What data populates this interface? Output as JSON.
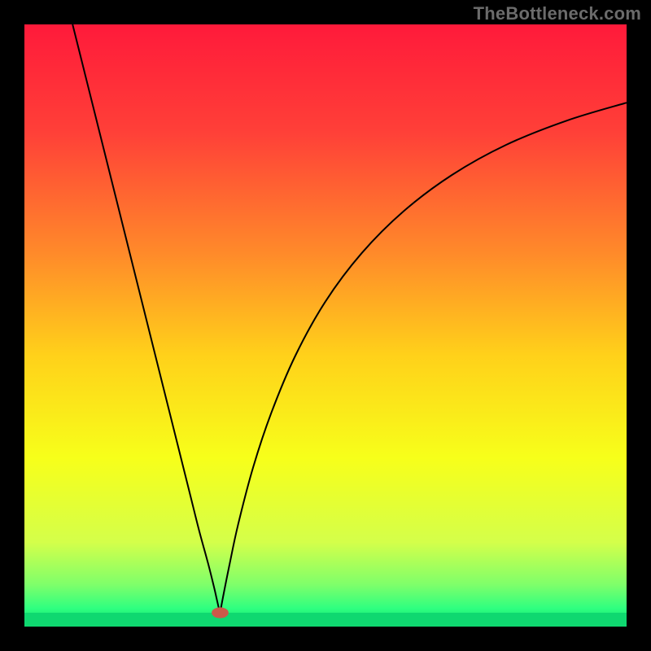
{
  "watermark": "TheBottleneck.com",
  "chart_data": {
    "type": "line",
    "title": "",
    "xlabel": "",
    "ylabel": "",
    "xlim": [
      0,
      100
    ],
    "ylim": [
      0,
      100
    ],
    "grid": false,
    "legend": false,
    "gradient_stops": [
      {
        "offset": 0.0,
        "color": "#ff1a3a"
      },
      {
        "offset": 0.18,
        "color": "#ff4038"
      },
      {
        "offset": 0.38,
        "color": "#ff8a2a"
      },
      {
        "offset": 0.55,
        "color": "#ffd11a"
      },
      {
        "offset": 0.72,
        "color": "#f7ff1a"
      },
      {
        "offset": 0.86,
        "color": "#d4ff4a"
      },
      {
        "offset": 0.93,
        "color": "#7fff6a"
      },
      {
        "offset": 0.97,
        "color": "#2eff80"
      },
      {
        "offset": 1.0,
        "color": "#0fd870"
      }
    ],
    "bottom_band": {
      "height_pct": 2.3,
      "color": "#0fd870"
    },
    "marker": {
      "x": 32.5,
      "y": 97.7,
      "rx": 1.4,
      "ry": 0.9,
      "color": "#cc5a4a"
    },
    "series": [
      {
        "name": "left-branch",
        "x": [
          8.0,
          10.0,
          12.5,
          15.0,
          17.5,
          20.0,
          22.5,
          25.0,
          27.5,
          29.0,
          30.5,
          31.5,
          32.0,
          32.3,
          32.5
        ],
        "y": [
          0.0,
          8.0,
          18.0,
          28.0,
          38.0,
          48.0,
          58.0,
          68.0,
          78.0,
          84.0,
          89.5,
          93.5,
          95.7,
          97.0,
          97.7
        ]
      },
      {
        "name": "right-branch",
        "x": [
          32.5,
          33.0,
          34.0,
          35.5,
          38.0,
          41.0,
          45.0,
          50.0,
          56.0,
          63.0,
          71.0,
          80.0,
          90.0,
          100.0
        ],
        "y": [
          97.7,
          95.0,
          90.0,
          83.0,
          73.5,
          64.5,
          55.0,
          46.0,
          38.0,
          31.0,
          25.0,
          20.0,
          16.0,
          13.0
        ]
      }
    ],
    "curve_style": {
      "stroke": "#000000",
      "stroke_width": 2.0
    }
  }
}
